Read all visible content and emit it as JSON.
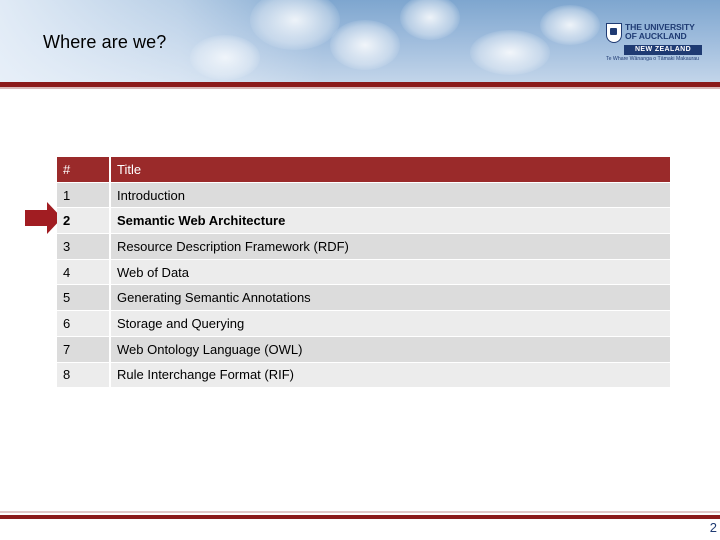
{
  "slide": {
    "title": "Where are we?",
    "page_number": "2"
  },
  "logo": {
    "name": "THE UNIVERSITY\nOF AUCKLAND",
    "country": "NEW ZEALAND",
    "motto": "Te Whare Wānanga o Tāmaki Makaurau"
  },
  "table": {
    "headers": {
      "num": "#",
      "title": "Title"
    },
    "rows": [
      {
        "num": "1",
        "title": "Introduction"
      },
      {
        "num": "2",
        "title": "Semantic Web Architecture"
      },
      {
        "num": "3",
        "title": "Resource Description Framework (RDF)"
      },
      {
        "num": "4",
        "title": "Web of Data"
      },
      {
        "num": "5",
        "title": "Generating Semantic Annotations"
      },
      {
        "num": "6",
        "title": "Storage and Querying"
      },
      {
        "num": "7",
        "title": "Web Ontology Language (OWL)"
      },
      {
        "num": "8",
        "title": "Rule Interchange Format (RIF)"
      }
    ],
    "current_row": "2"
  },
  "colors": {
    "accent": "#8b1a1a",
    "header_row": "#9a2a2a",
    "brand_blue": "#1f3b73"
  },
  "icons": {
    "marker": "right-arrow-icon",
    "crest": "university-crest-icon"
  }
}
